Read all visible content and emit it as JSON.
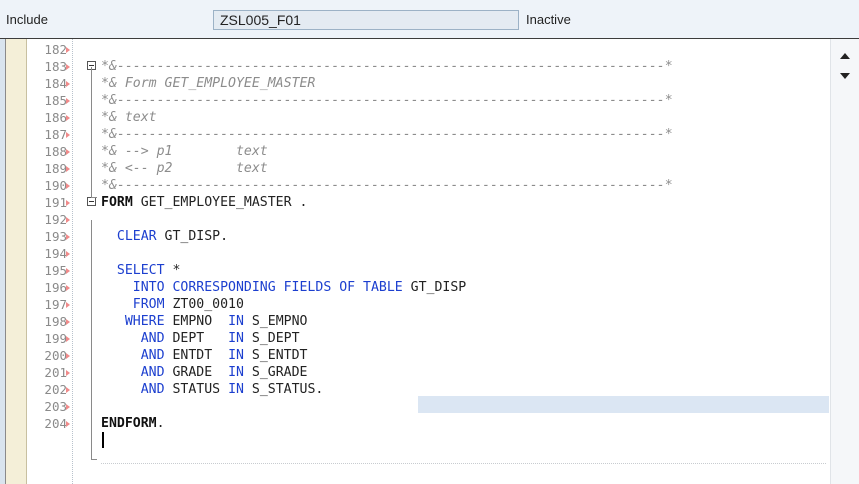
{
  "header": {
    "include_label": "Include",
    "program_name": "ZSL005_F01",
    "status": "Inactive"
  },
  "colors": {
    "keyword": "#1c3fcf",
    "comment": "#8c8c8c",
    "line_number": "#8a8a8a",
    "bookmark_marker": "#f08a8a",
    "header_bg": "#eef3f9",
    "current_line_highlight": "#dbe6f3"
  },
  "icons": {
    "scroll_up": "chevron-up-icon",
    "scroll_down": "chevron-down-icon",
    "fold": "collapse-box-icon"
  },
  "editor": {
    "cursor_line": 203,
    "lines": [
      {
        "n": "182",
        "tokens": []
      },
      {
        "n": "183",
        "tokens": [
          {
            "c": "cmt",
            "t": "*&---------------------------------------------------------------------*"
          }
        ]
      },
      {
        "n": "184",
        "tokens": [
          {
            "c": "cmt",
            "t": "*& Form GET_EMPLOYEE_MASTER"
          }
        ]
      },
      {
        "n": "185",
        "tokens": [
          {
            "c": "cmt",
            "t": "*&---------------------------------------------------------------------*"
          }
        ]
      },
      {
        "n": "186",
        "tokens": [
          {
            "c": "cmt",
            "t": "*& text"
          }
        ]
      },
      {
        "n": "187",
        "tokens": [
          {
            "c": "cmt",
            "t": "*&---------------------------------------------------------------------*"
          }
        ]
      },
      {
        "n": "188",
        "tokens": [
          {
            "c": "cmt",
            "t": "*& --> p1        text"
          }
        ]
      },
      {
        "n": "189",
        "tokens": [
          {
            "c": "cmt",
            "t": "*& <-- p2        text"
          }
        ]
      },
      {
        "n": "190",
        "tokens": [
          {
            "c": "cmt",
            "t": "*&---------------------------------------------------------------------*"
          }
        ]
      },
      {
        "n": "191",
        "tokens": [
          {
            "c": "kwb",
            "t": "FORM"
          },
          {
            "c": "",
            "t": " GET_EMPLOYEE_MASTER ."
          }
        ]
      },
      {
        "n": "192",
        "tokens": []
      },
      {
        "n": "193",
        "tokens": [
          {
            "c": "",
            "t": "  "
          },
          {
            "c": "kw",
            "t": "CLEAR"
          },
          {
            "c": "",
            "t": " GT_DISP."
          }
        ]
      },
      {
        "n": "194",
        "tokens": []
      },
      {
        "n": "195",
        "tokens": [
          {
            "c": "",
            "t": "  "
          },
          {
            "c": "kw",
            "t": "SELECT"
          },
          {
            "c": "",
            "t": " *"
          }
        ]
      },
      {
        "n": "196",
        "tokens": [
          {
            "c": "",
            "t": "    "
          },
          {
            "c": "kw",
            "t": "INTO CORRESPONDING FIELDS OF TABLE"
          },
          {
            "c": "",
            "t": " GT_DISP"
          }
        ]
      },
      {
        "n": "197",
        "tokens": [
          {
            "c": "",
            "t": "    "
          },
          {
            "c": "kw",
            "t": "FROM"
          },
          {
            "c": "",
            "t": " ZT00_0010"
          }
        ]
      },
      {
        "n": "198",
        "tokens": [
          {
            "c": "",
            "t": "   "
          },
          {
            "c": "kw",
            "t": "WHERE"
          },
          {
            "c": "",
            "t": " EMPNO  "
          },
          {
            "c": "kw",
            "t": "IN"
          },
          {
            "c": "",
            "t": " S_EMPNO"
          }
        ]
      },
      {
        "n": "199",
        "tokens": [
          {
            "c": "",
            "t": "     "
          },
          {
            "c": "kw",
            "t": "AND"
          },
          {
            "c": "",
            "t": " DEPT   "
          },
          {
            "c": "kw",
            "t": "IN"
          },
          {
            "c": "",
            "t": " S_DEPT"
          }
        ]
      },
      {
        "n": "200",
        "tokens": [
          {
            "c": "",
            "t": "     "
          },
          {
            "c": "kw",
            "t": "AND"
          },
          {
            "c": "",
            "t": " ENTDT  "
          },
          {
            "c": "kw",
            "t": "IN"
          },
          {
            "c": "",
            "t": " S_ENTDT"
          }
        ]
      },
      {
        "n": "201",
        "tokens": [
          {
            "c": "",
            "t": "     "
          },
          {
            "c": "kw",
            "t": "AND"
          },
          {
            "c": "",
            "t": " GRADE  "
          },
          {
            "c": "kw",
            "t": "IN"
          },
          {
            "c": "",
            "t": " S_GRADE"
          }
        ]
      },
      {
        "n": "202",
        "tokens": [
          {
            "c": "",
            "t": "     "
          },
          {
            "c": "kw",
            "t": "AND"
          },
          {
            "c": "",
            "t": " STATUS "
          },
          {
            "c": "kw",
            "t": "IN"
          },
          {
            "c": "",
            "t": " S_STATUS."
          }
        ]
      },
      {
        "n": "203",
        "tokens": []
      },
      {
        "n": "204",
        "tokens": [
          {
            "c": "kwb",
            "t": "ENDFORM"
          },
          {
            "c": "",
            "t": "."
          }
        ]
      }
    ]
  }
}
